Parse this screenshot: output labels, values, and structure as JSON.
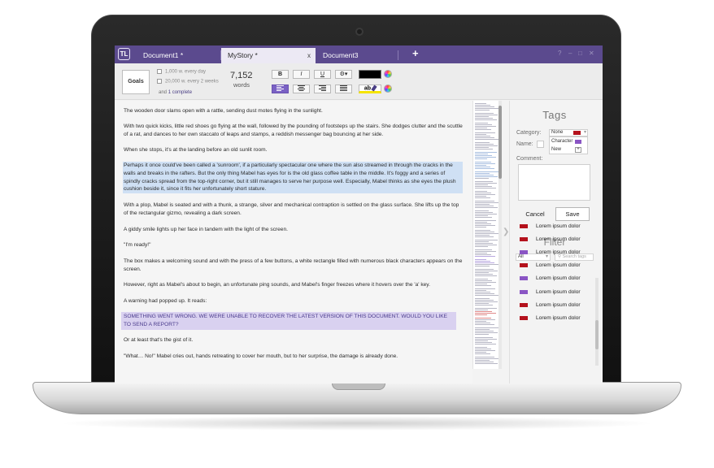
{
  "app": {
    "logo": "TL"
  },
  "tabs": [
    {
      "label": "Document1 *"
    },
    {
      "label": "MyStory *",
      "close": "x"
    },
    {
      "label": "Document3"
    }
  ],
  "new_tab": "+",
  "window_controls": [
    "?",
    "–",
    "□",
    "✕"
  ],
  "toolbar": {
    "goals_label": "Goals",
    "goals": [
      "1,000 w. every day",
      "20,000 w. every 2 weeks"
    ],
    "goal_status_prefix": "and",
    "goal_status_highlight": "1 complete",
    "word_count": "7,152",
    "word_label": "words",
    "bold": "B",
    "italic": "I",
    "underline": "U",
    "settings": "⚙▾",
    "highlight_label": "ab",
    "font_color": "#000000",
    "highlight_color": "#f5e400",
    "accent": "#7a61c4"
  },
  "document": {
    "paragraphs": [
      "The wooden door slams open with a rattle, sending dust motes flying in the sunlight.",
      "With two quick kicks, little red shoes go flying at the wall, followed by the pounding of footsteps up the stairs. She dodges clutter and the scuttle of a rat, and dances to her own staccato of leaps and stamps, a reddish messenger bag bouncing at her side.",
      "When she stops, it's at the landing before an old sunlit room.",
      "Perhaps it once could've been called a 'sunroom', if a particularly spectacular one where the sun also streamed in through the cracks in the walls and breaks in the rafters. But the only thing Mabel has eyes for is the old glass coffee table in the middle. It's foggy and a series of spindly cracks spread from the top-right corner, but it still manages to serve her purpose well. Especially, Mabel thinks as she eyes the plush cushion beside it, since it fits her unfortunately short stature.",
      "With a plop, Mabel is seated and with a thunk, a strange, silver and mechanical contraption is settled on the glass surface. She lifts up the top of the rectangular gizmo, revealing a dark screen.",
      "A giddy smile lights up her face in tandem with the light of the screen.",
      "\"I'm ready!\"",
      "The box makes a welcoming sound and with the press of a few buttons, a white rectangle filled with numerous black characters appears on the screen.",
      "However, right as Mabel's about to begin, an unfortunate ping sounds, and Mabel's finger freezes where it hovers over the 'a' key.",
      "A warning had popped up. It reads:",
      "SOMETHING WENT WRONG. WE WERE UNABLE TO RECOVER THE LATEST VERSION OF THIS DOCUMENT. WOULD YOU LIKE TO SEND A REPORT?",
      "Or at least that's the gist of it.",
      "\"What… No!\" Mabel cries out, hands retreating to cover her mouth, but to her surprise, the damage is already done."
    ]
  },
  "tags_panel": {
    "title": "Tags",
    "category_label": "Category:",
    "name_label": "Name:",
    "comment_label": "Comment:",
    "category_selected": "None",
    "category_options": [
      "Character",
      "New"
    ],
    "add_symbol": "+",
    "cancel": "Cancel",
    "save": "Save"
  },
  "filter_panel": {
    "title": "Filter",
    "selected": "All",
    "search_placeholder": "Search tags",
    "items": [
      {
        "label": "Lorem ipsum dolor",
        "color": "#b4111c"
      },
      {
        "label": "Lorem ipsum dolor",
        "color": "#b4111c"
      },
      {
        "label": "Lorem ipsum dolor",
        "color": "#8a55c4"
      },
      {
        "label": "Lorem ipsum dolor",
        "color": "#b4111c"
      },
      {
        "label": "Lorem ipsum dolor",
        "color": "#8a55c4"
      },
      {
        "label": "Lorem ipsum dolor",
        "color": "#8a55c4"
      },
      {
        "label": "Lorem ipsum dolor",
        "color": "#b4111c"
      },
      {
        "label": "Lorem ipsum dolor",
        "color": "#b4111c"
      }
    ]
  },
  "colors": {
    "tab_bar": "#5b4a8e",
    "tag_red": "#b4111c",
    "tag_purple": "#8a55c4"
  }
}
